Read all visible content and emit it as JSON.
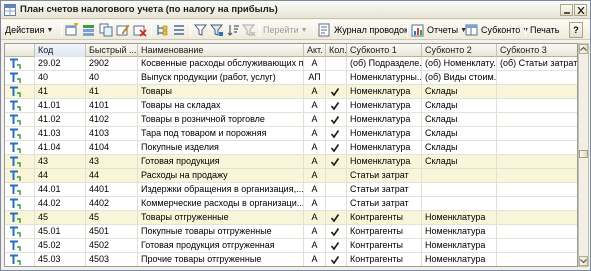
{
  "window": {
    "title": "План счетов налогового учета (по налогу на прибыль)",
    "icon": "table-window-icon"
  },
  "toolbar": {
    "actions_label": "Действия",
    "goto_label": "Перейти",
    "journal_label": "Журнал проводок",
    "reports_label": "Отчеты",
    "subconto_label": "Субконто",
    "print_label": "Печать",
    "help_label": "?"
  },
  "table": {
    "columns": {
      "code": "Код",
      "quick": "Быстрый ...",
      "name": "Наименование",
      "akt": "Акт.",
      "kol": "Кол.",
      "sub1": "Субконто 1",
      "sub2": "Субконто 2",
      "sub3": "Субконто 3"
    },
    "rows": [
      {
        "code": "29.02",
        "quick": "2902",
        "name": "Косвенные расходы обслуживающих п...",
        "akt": "А",
        "kol": "",
        "sub1": "(об) Подразделе...",
        "sub2": "(об) Номенклату...",
        "sub3": "(об) Статьи затрат",
        "style": "normal"
      },
      {
        "code": "40",
        "quick": "40",
        "name": "Выпуск продукции (работ, услуг)",
        "akt": "АП",
        "kol": "",
        "sub1": "Номенклатурны...",
        "sub2": "(об) Виды стоим...",
        "sub3": "",
        "style": "normal"
      },
      {
        "code": "41",
        "quick": "41",
        "name": "Товары",
        "akt": "А",
        "kol": "✔",
        "sub1": "Номенклатура",
        "sub2": "Склады",
        "sub3": "",
        "style": "group"
      },
      {
        "code": "41.01",
        "quick": "4101",
        "name": "Товары на складах",
        "akt": "А",
        "kol": "✔",
        "sub1": "Номенклатура",
        "sub2": "Склады",
        "sub3": "",
        "style": "normal"
      },
      {
        "code": "41.02",
        "quick": "4102",
        "name": "Товары в розничной торговле",
        "akt": "А",
        "kol": "✔",
        "sub1": "Номенклатура",
        "sub2": "Склады",
        "sub3": "",
        "style": "normal"
      },
      {
        "code": "41.03",
        "quick": "4103",
        "name": "Тара под товаром и порожняя",
        "akt": "А",
        "kol": "✔",
        "sub1": "Номенклатура",
        "sub2": "Склады",
        "sub3": "",
        "style": "normal"
      },
      {
        "code": "41.04",
        "quick": "4104",
        "name": "Покупные изделия",
        "akt": "А",
        "kol": "✔",
        "sub1": "Номенклатура",
        "sub2": "Склады",
        "sub3": "",
        "style": "normal"
      },
      {
        "code": "43",
        "quick": "43",
        "name": "Готовая продукция",
        "akt": "А",
        "kol": "✔",
        "sub1": "Номенклатура",
        "sub2": "Склады",
        "sub3": "",
        "style": "group"
      },
      {
        "code": "44",
        "quick": "44",
        "name": "Расходы на продажу",
        "akt": "А",
        "kol": "",
        "sub1": "Статьи затрат",
        "sub2": "",
        "sub3": "",
        "style": "group"
      },
      {
        "code": "44.01",
        "quick": "4401",
        "name": "Издержки обращения в организация,...",
        "akt": "А",
        "kol": "",
        "sub1": "Статьи затрат",
        "sub2": "",
        "sub3": "",
        "style": "normal"
      },
      {
        "code": "44.02",
        "quick": "4402",
        "name": "Коммерческие расходы в организаци...",
        "akt": "А",
        "kol": "",
        "sub1": "Статьи затрат",
        "sub2": "",
        "sub3": "",
        "style": "normal"
      },
      {
        "code": "45",
        "quick": "45",
        "name": "Товары отгруженные",
        "akt": "А",
        "kol": "✔",
        "sub1": "Контрагенты",
        "sub2": "Номенклатура",
        "sub3": "",
        "style": "group"
      },
      {
        "code": "45.01",
        "quick": "4501",
        "name": "Покупные товары отгруженные",
        "akt": "А",
        "kol": "✔",
        "sub1": "Контрагенты",
        "sub2": "Номенклатура",
        "sub3": "",
        "style": "normal"
      },
      {
        "code": "45.02",
        "quick": "4502",
        "name": "Готовая продукция отгруженная",
        "akt": "А",
        "kol": "✔",
        "sub1": "Контрагенты",
        "sub2": "Номенклатура",
        "sub3": "",
        "style": "normal"
      },
      {
        "code": "45.03",
        "quick": "4503",
        "name": "Прочие товары отгруженные",
        "akt": "А",
        "kol": "✔",
        "sub1": "Контрагенты",
        "sub2": "Номенклатура",
        "sub3": "",
        "style": "normal"
      },
      {
        "code": "58",
        "quick": "58",
        "name": "Финансовые вложения",
        "akt": "А",
        "kol": "",
        "sub1": "",
        "sub2": "",
        "sub3": "",
        "style": "group"
      }
    ]
  },
  "colors": {
    "group_row": "#f8f5d8",
    "row_icon": "#2b6ec2",
    "check": "#1a1a1a"
  }
}
